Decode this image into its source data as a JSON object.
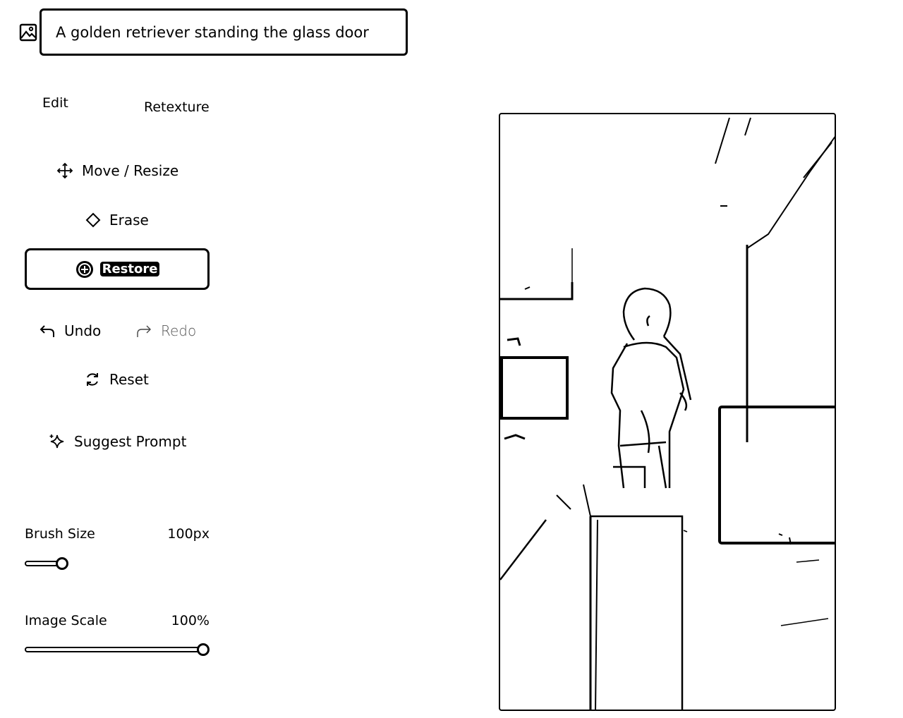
{
  "prompt": {
    "value": "A golden retriever standing the glass door",
    "icon": "image-icon"
  },
  "tabs": [
    {
      "label": "Edit"
    },
    {
      "label": "Retexture"
    }
  ],
  "tools": {
    "move_resize": {
      "label": "Move / Resize",
      "icon": "move-icon"
    },
    "erase": {
      "label": "Erase",
      "icon": "eraser-icon"
    },
    "restore": {
      "label": "Restore",
      "icon": "restore-icon",
      "active": true
    },
    "undo": {
      "label": "Undo",
      "icon": "undo-icon"
    },
    "redo": {
      "label": "Redo",
      "icon": "redo-icon",
      "disabled": true
    },
    "reset": {
      "label": "Reset",
      "icon": "reset-icon"
    },
    "suggest_prompt": {
      "label": "Suggest Prompt",
      "icon": "sparkle-icon"
    }
  },
  "brush_size": {
    "label": "Brush Size",
    "value_text": "100px",
    "fraction": 0.1
  },
  "image_scale": {
    "label": "Image Scale",
    "value_text": "100%",
    "fraction": 1.0
  },
  "canvas": {
    "description_icon": "photo-canvas"
  }
}
